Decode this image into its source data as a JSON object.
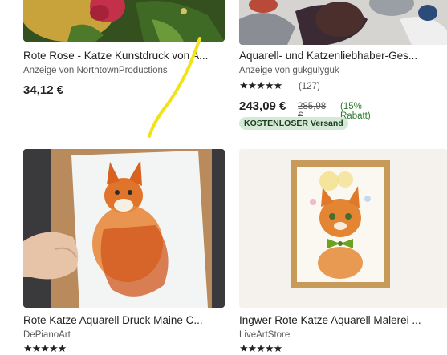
{
  "listings": [
    {
      "title": "Rote Rose - Katze Kunstdruck von A...",
      "seller": "Anzeige von NorthtownProductions",
      "price": "34,12 €"
    },
    {
      "title": "Aquarell- und Katzenliebhaber-Ges...",
      "seller": "Anzeige von gukgulyguk",
      "rating_stars": "★★★★★",
      "rating_value": 5,
      "review_count": "(127)",
      "price": "243,09 €",
      "original_price": "285,98 €",
      "discount": "(15% Rabatt)",
      "badge": "KOSTENLOSER Versand"
    },
    {
      "title": "Rote Katze Aquarell Druck Maine C...",
      "seller": "DePianoArt",
      "rating_stars": "★★★★★"
    },
    {
      "title": "Ingwer Rote Katze Aquarell Malerei ...",
      "seller": "LiveArtStore",
      "rating_stars": "★★★★★"
    }
  ],
  "colors": {
    "text": "#222222",
    "muted": "#595959",
    "discount_green": "#2c7a2c",
    "badge_bg": "#d4e9d7",
    "annotation_yellow": "#f2e21a"
  }
}
